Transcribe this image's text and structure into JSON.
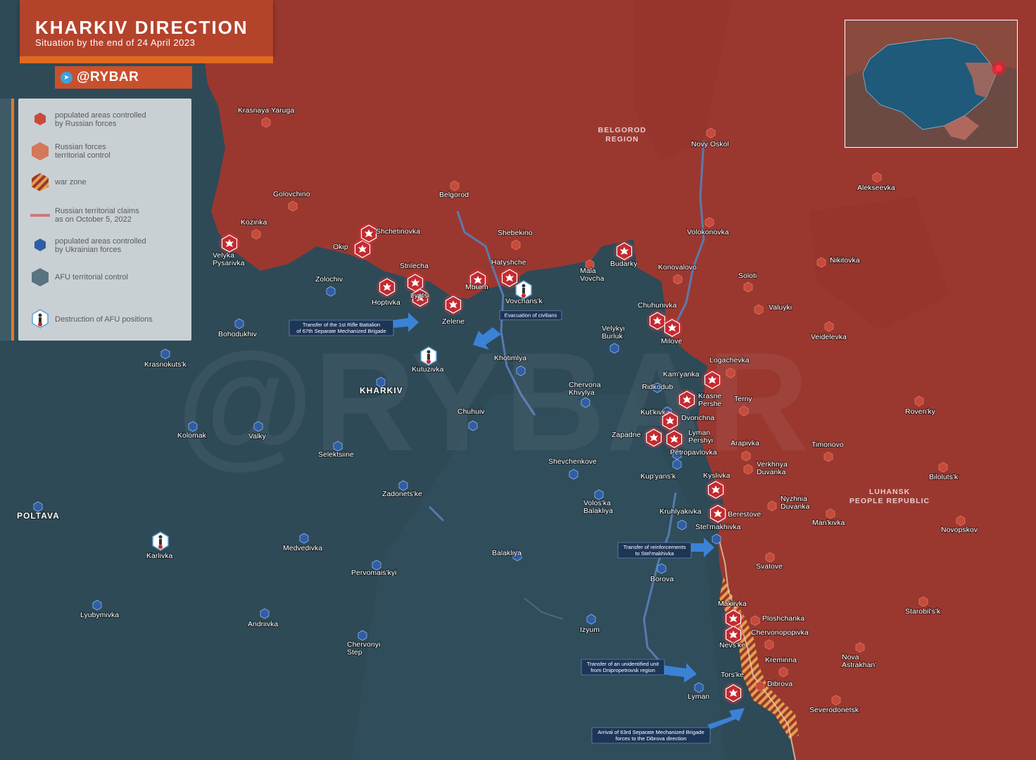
{
  "header": {
    "title": "KHARKIV DIRECTION",
    "subtitle": "Situation by the end of 24 April 2023"
  },
  "brand": {
    "name": "@RYBAR",
    "icon": "telegram-icon"
  },
  "legend": {
    "items": [
      {
        "label": "populated areas controlled\nby Russian forces",
        "icon": "red-hexagon-pin-icon"
      },
      {
        "label": "Russian forces\nterritorial control",
        "icon": "red-hexagon-icon"
      },
      {
        "label": "war zone",
        "icon": "hatched-hexagon-icon"
      },
      {
        "label": "Russian territorial claims\nas on October 5, 2022",
        "icon": "claim-line-icon"
      },
      {
        "label": "populated areas controlled\nby Ukrainian forces",
        "icon": "blue-hexagon-pin-icon"
      },
      {
        "label": "AFU territorial control",
        "icon": "blue-hexagon-icon"
      },
      {
        "label": "Destruction of AFU positions",
        "icon": "soldier-hexagon-icon"
      }
    ]
  },
  "regions": {
    "belgorod": "BELGOROD\nREGION",
    "luhansk": "LUHANSK\nPEOPLE REPUBLIC"
  },
  "colors": {
    "russian": "#9a3830",
    "ukrainian": "#2e4a57",
    "war_zone": "#e3a04a",
    "strike": "#c42a30",
    "arrow": "#3b82d6"
  },
  "russian_towns": [
    "Krasnaya Yaruga",
    "Golovchino",
    "Kozinka",
    "Belgorod",
    "Shebekino",
    "Novy Oskol",
    "Alekseevka",
    "Volokonovka",
    "Nikitovka",
    "Konovalovo",
    "Soloti",
    "Valuyki",
    "Veidelevka",
    "Logachevka",
    "Terny",
    "Roven'ky",
    "Arapivka",
    "Verkhnya\nDuvanka",
    "Timonovo",
    "Biloluts'k",
    "Nyzhnia\nDuvanka",
    "Man'kivka",
    "Novopskov",
    "Svatove",
    "Starobil's'k",
    "Ploshchanka",
    "Chervonopopivka",
    "Kreminna",
    "Dibrova",
    "Nova\nAstrakhan'",
    "Severodonetsk",
    "Mala\nVovcha"
  ],
  "strike_towns": [
    "Velyka\nPysarivka",
    "Okip",
    "Shchetinovka",
    "Strilecha",
    "Hoptivka",
    "Lyptsi",
    "Zelene",
    "Murom",
    "Hatyshche",
    "Budarky",
    "Chuhunivka",
    "Milove",
    "Kam'yanka",
    "Krasne\nPershe",
    "Dvorichna",
    "Lyman\nPershyi",
    "Zapadne",
    "Kyslivka",
    "Berestove",
    "Makiivka",
    "Nevs'ke",
    "Tors'ke"
  ],
  "ukrainian_towns": [
    "Zolochiv",
    "Bohodukhiv",
    "Krasnokuts'k",
    "Kolomak",
    "Valky",
    "Selektsiine",
    "Zadonets'ke",
    "Medvedivka",
    "Pervomais'kyi",
    "Andriivka",
    "Chervonyi\nStep",
    "Lyubymivka",
    "Balakliya",
    "Izyum",
    "Chuhuiv",
    "Khotimlya",
    "Velykyi\nBurluk",
    "Chervona\nKhvylya",
    "Shevchenkove",
    "Volos'ka\nBalakliya",
    "Kut'kivka",
    "Ridkodub",
    "Kup'yans'k",
    "Petropavlovka",
    "Kruhlyakivka",
    "Stel'makhivka",
    "Borova",
    "Lyman"
  ],
  "afu_positions": [
    "Vovchans'k",
    "Kutuzivka",
    "Karlivka"
  ],
  "cities": [
    "KHARKIV",
    "POLTAVA"
  ],
  "callouts": [
    "Transfer of the 1st Rifle Battalion\nof 67th Separate Mechanized Brigade",
    "Evacuation of civilians",
    "Transfer of reinforcements\nto Stel'makhivka",
    "Transfer of an unidentified unit\nfrom Dnipropetrovsk region",
    "Arrival of 63rd Separate Mechanized Brigade\nforces to the Dibrova direction"
  ]
}
